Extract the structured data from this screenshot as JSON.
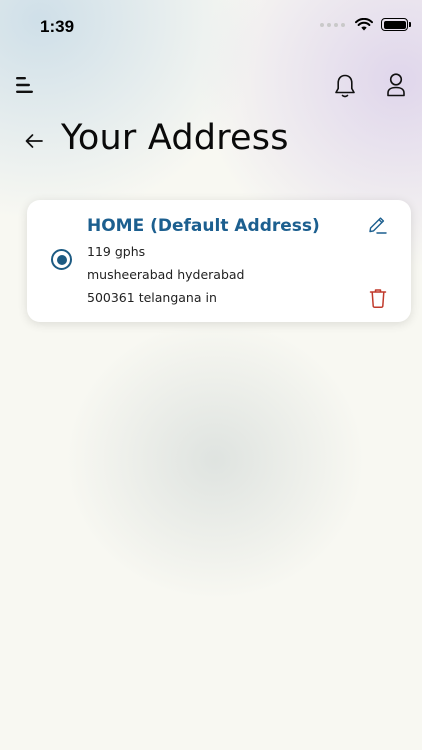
{
  "status_bar": {
    "time": "1:39",
    "icons": [
      "signal-dots-icon",
      "wifi-icon",
      "battery-icon"
    ]
  },
  "header": {
    "menu_icon": "menu-icon",
    "notification_icon": "bell-icon",
    "profile_icon": "user-icon"
  },
  "page": {
    "back_icon": "back-arrow-icon",
    "title": "Your Address"
  },
  "address": {
    "selected": true,
    "title": "HOME  (Default Address)",
    "line1": "119 gphs",
    "line2": "musheerabad hyderabad",
    "line3": "500361 telangana in",
    "edit_icon": "pencil-icon",
    "delete_icon": "trash-icon"
  },
  "colors": {
    "accent": "#1c5f8f",
    "delete": "#c0392b",
    "card_bg": "#ffffff"
  }
}
